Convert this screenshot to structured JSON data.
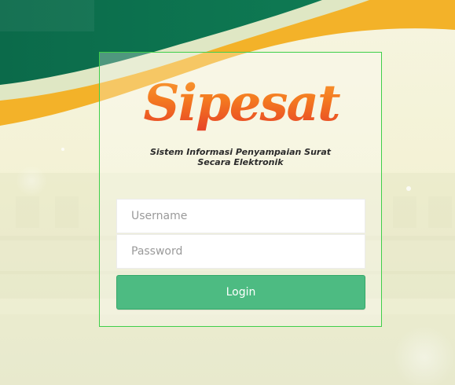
{
  "brand": {
    "logo_text": "Sipesat",
    "tagline_line1": "Sistem Informasi Penyampaian Surat",
    "tagline_line2": "Secara Elektronik"
  },
  "form": {
    "username_placeholder": "Username",
    "password_placeholder": "Password",
    "login_label": "Login"
  },
  "colors": {
    "accent_green": "#4dbb82",
    "box_border": "#3fcf4a",
    "dark_green": "#0c6b4c",
    "gold": "#f3b229",
    "logo_orange": "#f47a20",
    "logo_red": "#e0262b"
  }
}
